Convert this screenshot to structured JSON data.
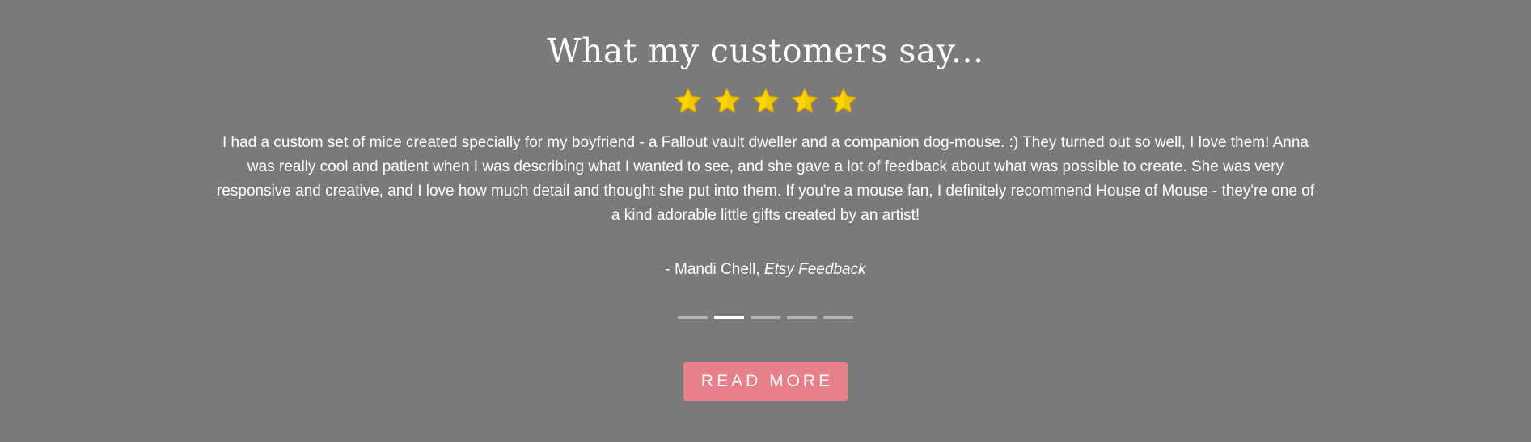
{
  "testimonials": {
    "title": "What my customers say...",
    "rating": {
      "stars": 5,
      "max": 5,
      "star_color": "#FFD700",
      "star_outline": "#E0A800"
    },
    "quote": "I had a custom set of mice created specially for my boyfriend - a Fallout vault dweller and a companion dog-mouse. :) They turned out so well, I love them! Anna was really cool and patient when I was describing what I wanted to see, and she gave a lot of feedback about what was possible to create. She was very responsive and creative, and I love how much detail and thought she put into them. If you're a mouse fan, I definitely recommend House of Mouse - they're one of a kind adorable little gifts created by an artist!",
    "author": "- Mandi Chell,",
    "source": "Etsy Feedback",
    "slides": {
      "count": 5,
      "active_index": 1
    },
    "read_more_label": "READ MORE"
  },
  "colors": {
    "background": "#7a7a7a",
    "text": "#ffffff",
    "button": "#e8808a",
    "indicator_inactive": "#b5b5b5",
    "indicator_active": "#ffffff"
  }
}
